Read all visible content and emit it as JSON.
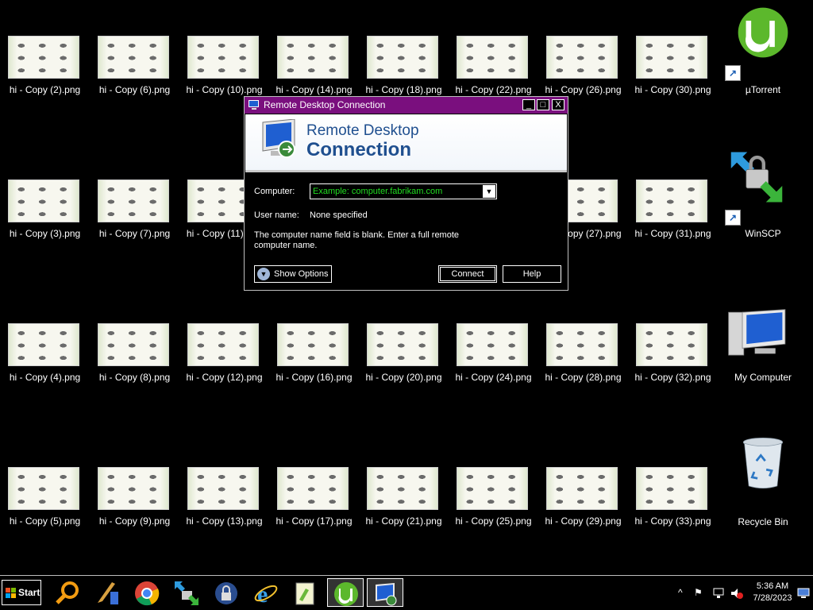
{
  "desktop": {
    "icons": [
      "hi - Copy (2).png",
      "hi - Copy (6).png",
      "hi - Copy (10).png",
      "hi - Copy (14).png",
      "hi - Copy (18).png",
      "hi - Copy (22).png",
      "hi - Copy (26).png",
      "hi - Copy (30).png",
      "hi - Copy (3).png",
      "hi - Copy (7).png",
      "hi - Copy (11).png",
      "hi - Copy (27).png",
      "hi - Copy (31).png",
      "hi - Copy (4).png",
      "hi - Copy (8).png",
      "hi - Copy (12).png",
      "hi - Copy (16).png",
      "hi - Copy (20).png",
      "hi - Copy (24).png",
      "hi - Copy (28).png",
      "hi - Copy (32).png",
      "hi - Copy (5).png",
      "hi - Copy (9).png",
      "hi - Copy (13).png",
      "hi - Copy (17).png",
      "hi - Copy (21).png",
      "hi - Copy (25).png",
      "hi - Copy (29).png",
      "hi - Copy (33).png"
    ],
    "apps": {
      "utorrent": "µTorrent",
      "winscp": "WinSCP",
      "my_computer": "My Computer",
      "recycle_bin": "Recycle Bin"
    }
  },
  "rdc": {
    "title": "Remote Desktop Connection",
    "banner_line1": "Remote Desktop",
    "banner_line2": "Connection",
    "computer_label": "Computer:",
    "computer_placeholder": "Example: computer.fabrikam.com",
    "username_label": "User name:",
    "username_value": "None specified",
    "message": "The computer name field is blank. Enter a full remote computer name.",
    "show_options": "Show Options",
    "connect": "Connect",
    "help": "Help",
    "minimize": "_",
    "maximize": "□",
    "close": "X"
  },
  "taskbar": {
    "start": "Start",
    "items": [
      "search-icon",
      "paint-icon",
      "chrome-icon",
      "winscp-icon",
      "keepass-icon",
      "internet-explorer-icon",
      "notepadpp-icon",
      "utorrent-icon",
      "remote-desktop-icon"
    ],
    "tray": {
      "time": "5:36 AM",
      "date": "7/28/2023",
      "chevron": "^",
      "flag": "⚑"
    }
  },
  "colors": {
    "rdc_titlebar": "#7a0f7e",
    "placeholder_green": "#22dd22",
    "banner_text": "#1f4f8f"
  }
}
